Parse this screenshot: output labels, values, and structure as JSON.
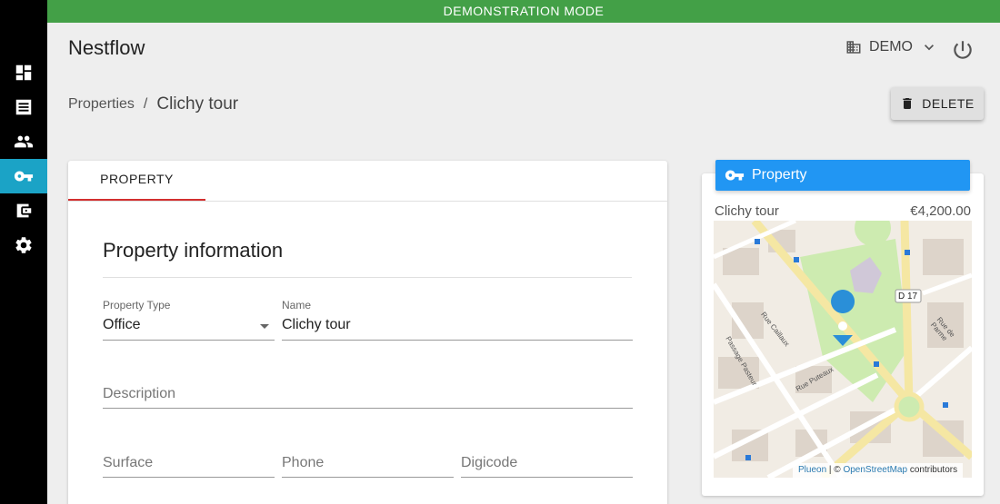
{
  "banner": {
    "text": "DEMONSTRATION MODE"
  },
  "header": {
    "app_title": "Nestflow",
    "org_label": "DEMO"
  },
  "sidebar": {
    "items": [
      {
        "name": "dashboard",
        "icon": "dashboard-icon"
      },
      {
        "name": "leases",
        "icon": "document-icon"
      },
      {
        "name": "tenants",
        "icon": "people-icon"
      },
      {
        "name": "properties",
        "icon": "key-icon",
        "active": true
      },
      {
        "name": "accounting",
        "icon": "wallet-icon"
      },
      {
        "name": "settings",
        "icon": "gear-icon"
      }
    ]
  },
  "breadcrumb": {
    "parent": "Properties",
    "separator": "/",
    "current": "Clichy tour"
  },
  "toolbar": {
    "delete_label": "DELETE"
  },
  "tabs": [
    {
      "label": "PROPERTY",
      "active": true
    }
  ],
  "form": {
    "section_title": "Property information",
    "property_type": {
      "label": "Property Type",
      "value": "Office"
    },
    "name": {
      "label": "Name",
      "value": "Clichy tour"
    },
    "description": {
      "placeholder": "Description"
    },
    "surface": {
      "placeholder": "Surface"
    },
    "phone": {
      "placeholder": "Phone"
    },
    "digicode": {
      "placeholder": "Digicode"
    }
  },
  "summary": {
    "header": "Property",
    "name": "Clichy tour",
    "price": "€4,200.00"
  },
  "map": {
    "road_label": "D 17",
    "street_labels": [
      "Rue Caillaux",
      "Passage Pasteur",
      "Rue de Parme",
      "Rue Puteaux"
    ],
    "attribution": {
      "provider": "Plueon",
      "separator": " | © ",
      "osm": "OpenStreetMap",
      "suffix": " contributors"
    }
  },
  "colors": {
    "accent_green": "#43a047",
    "active_nav": "#1ba3c6",
    "header_blue": "#2196f3",
    "tab_underline": "#d32f2f"
  }
}
